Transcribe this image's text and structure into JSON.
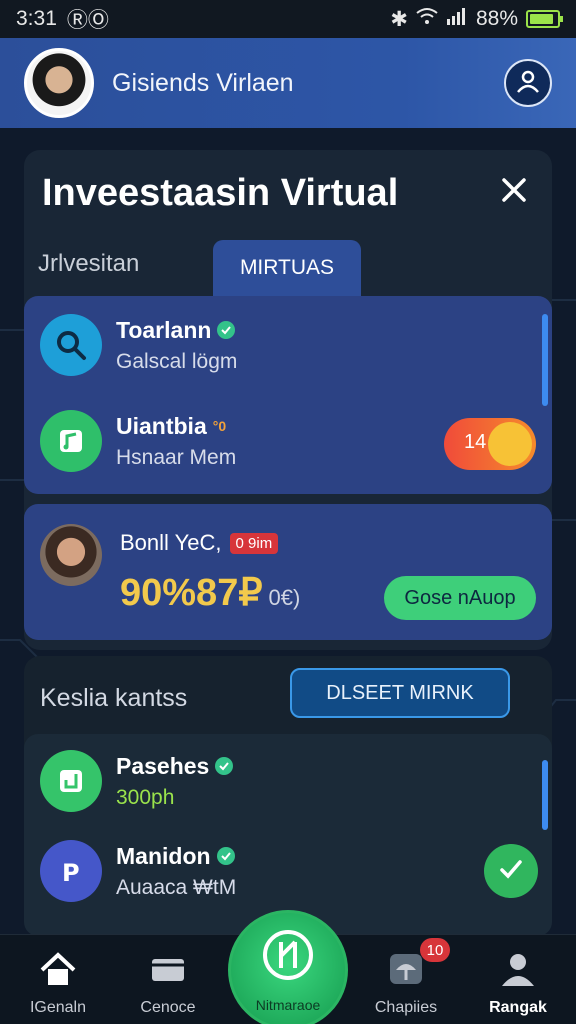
{
  "status_bar": {
    "time": "3:31",
    "extra": "ⓇⓄ",
    "battery_text": "88%",
    "battery_level": 0.88
  },
  "header": {
    "user_name": "Gisiends Virlaen"
  },
  "panel": {
    "title": "Inveestaasin Virtual",
    "tabs": [
      {
        "label": "Jrlvesitan",
        "active": false
      },
      {
        "label": "MIRTUAS",
        "active": true
      }
    ],
    "items": [
      {
        "title": "Toarlann",
        "subtitle": "Galscal lögm",
        "icon": "search-icon",
        "icon_color": "#1e9fd8"
      },
      {
        "title": "Uiantbia",
        "subtitle": "Hsnaar Mem",
        "icon": "music-note-icon",
        "icon_color": "#2fbf6a",
        "tag": "°0",
        "toggle_value": "14"
      }
    ]
  },
  "stat_card": {
    "label": "Bonll YeC,",
    "badge": "0 9im",
    "value": "90%87₽",
    "value_suffix": "0€)",
    "action": "Gose nAuop"
  },
  "section": {
    "title": "Keslia kantss",
    "select_button": "DLSEET MIRNK",
    "items": [
      {
        "title": "Pasehes",
        "subtitle": "300ph",
        "icon": "download-icon",
        "icon_color": "#35c46a"
      },
      {
        "title": "Manidon",
        "subtitle": "Auaaca ₩tM",
        "icon": "parking-icon",
        "icon_color": "#4557c9"
      }
    ]
  },
  "bottom_nav": {
    "items": [
      {
        "label": "IGenaln",
        "icon": "home-icon"
      },
      {
        "label": "Cenoce",
        "icon": "wallet-icon"
      },
      {
        "label": "Nitmaraoe",
        "icon": "center-icon"
      },
      {
        "label": "Chapiies",
        "icon": "umbrella-icon",
        "badge": "10"
      },
      {
        "label": "Rangak",
        "icon": "profile-icon"
      }
    ]
  }
}
